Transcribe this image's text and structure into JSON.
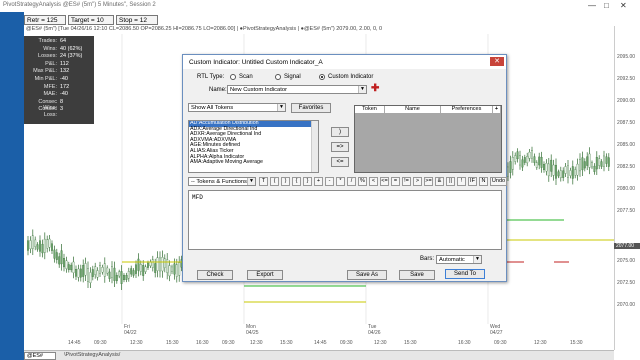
{
  "window": {
    "title": "PivotStrategyAnalysis @ES# (5m\") 5 Minutes\", Session 2",
    "controls": [
      "—",
      "□",
      "✕"
    ]
  },
  "params": [
    {
      "label": "Retr = 125"
    },
    {
      "label": "Target = 10"
    },
    {
      "label": "Stop = 12"
    }
  ],
  "chart": {
    "header": "@ES# (5m\") [Tue 04/26/16 12:10 CL=2086.50 OP=2086.25 HI=2086.75 LO=2086.00]  |  ●PivotStrategyAnalysis  |  ●@ES# (5m\") 2079.00, 2.00, 0, 0",
    "price_labels": [
      "2095.00",
      "2092.50",
      "2090.00",
      "2087.50",
      "2085.00",
      "2082.50",
      "2080.00",
      "2077.50",
      "2075.00",
      "2072.50",
      "2070.00"
    ],
    "last_price": "2077.00",
    "x_ticks": [
      "14:45",
      "09:30",
      "12:30",
      "15:30",
      "16:30",
      "09:30",
      "12:30",
      "15:30",
      "14:45",
      "09:30",
      "12:30",
      "15:30",
      "16:30",
      "09:30",
      "12:30",
      "15:30"
    ],
    "days": [
      "Fri\n04/22",
      "Mon\n04/25",
      "Tue\n04/26",
      "Wed\n04/27"
    ],
    "colors": {
      "candle": "#2f6b2f",
      "support": "#c8c800",
      "resistance": "#2ab52a",
      "stop": "#c02020"
    }
  },
  "performance": [
    {
      "k": "Trades:",
      "v": "64"
    },
    {
      "k": "Wins:",
      "v": "40 (62%)"
    },
    {
      "k": "Losses:",
      "v": "24 (37%)"
    },
    {
      "k": "P&L:",
      "v": "112"
    },
    {
      "k": "Max P&L:",
      "v": "132"
    },
    {
      "k": "Min P&L:",
      "v": "-40"
    },
    {
      "k": "MFE:",
      "v": "172"
    },
    {
      "k": "MAE:",
      "v": "-40"
    },
    {
      "k": "Consec Wins:",
      "v": "8"
    },
    {
      "k": "Consec Loss:",
      "v": "3"
    }
  ],
  "status": {
    "symbol": "@ES#",
    "study": "\\PivotStrategyAnalysis/"
  },
  "dialog": {
    "title": "Custom Indicator: Untitled Custom Indicator_A",
    "rtl_label": "RTL Type:",
    "rtl_options": [
      "Scan",
      "Signal",
      "Custom Indicator"
    ],
    "rtl_selected": 2,
    "name_label": "Name:",
    "name_value": "New Custom Indicator",
    "show_tokens": "Show All Tokens",
    "favorites": "Favorites",
    "tokens": [
      "AD:Accumulation Distribution",
      "ADX:Average Directional Ind",
      "ADXR:Average Directional Ind",
      "ADXVMA:ADXVMA",
      "AGE:Minutes defined",
      "ALIAS:Alias Ticker",
      "ALPHA:Alpha Indicator",
      "AMA:Adaptive Moving Average"
    ],
    "mid_buttons": [
      ")",
      "=>",
      "<="
    ],
    "grid_headers": [
      "Token",
      "Name",
      "Preferences"
    ],
    "tokens_functions": "-- Tokens & Functions --",
    "ops": [
      "T",
      "(",
      ")",
      "{",
      "}",
      "+",
      "-",
      "*",
      "/",
      "%",
      "<",
      "<=",
      "=",
      "!=",
      ">",
      ">=",
      "&",
      "||",
      "!",
      "IF",
      "N",
      "Undo"
    ],
    "editor_text": "MFD",
    "bars_label": "Bars:",
    "bars_value": "Automatic",
    "buttons": {
      "check": "Check",
      "export": "Export",
      "save_as": "Save As",
      "save": "Save",
      "send": "Send To"
    }
  }
}
